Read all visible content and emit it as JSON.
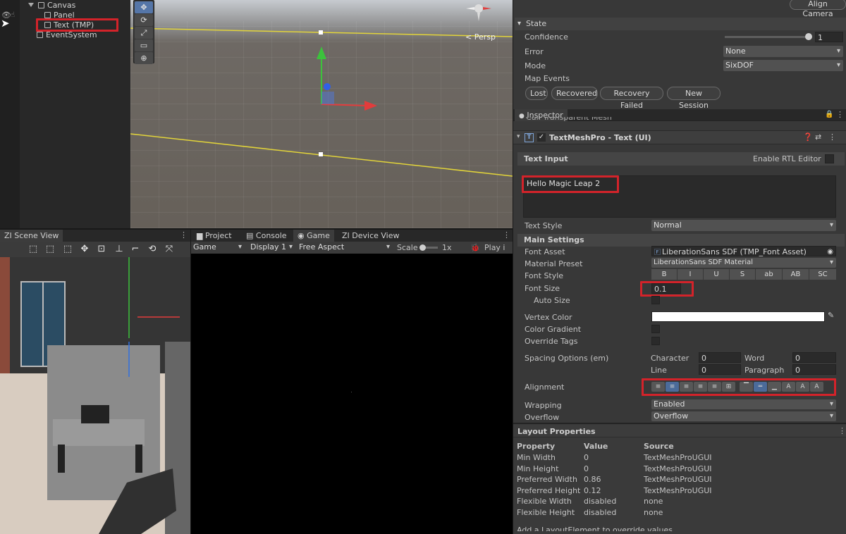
{
  "hierarchy": {
    "items": [
      {
        "label": "Canvas"
      },
      {
        "label": "Panel"
      },
      {
        "label": "Text (TMP)"
      },
      {
        "label": "EventSystem"
      }
    ]
  },
  "scene_top": {
    "persp_label": "< Persp",
    "tools": [
      "✥",
      "⟳",
      "⤢",
      "▭",
      "⊕"
    ]
  },
  "state_panel": {
    "align_camera": "Align Camera",
    "section": "State",
    "confidence_label": "Confidence",
    "confidence_value": "1",
    "confidence_fraction": 1.0,
    "error_label": "Error",
    "error_value": "None",
    "mode_label": "Mode",
    "mode_value": "SixDOF",
    "map_events_label": "Map Events",
    "buttons": [
      "Lost",
      "Recovered",
      "Recovery Failed",
      "New Session"
    ]
  },
  "inspector": {
    "tab": "Inspector",
    "cut_row": "Cull Transparent Mesh",
    "component_title": "TextMeshPro - Text (UI)",
    "text_input_label": "Text Input",
    "rtl_label": "Enable RTL Editor",
    "text_value": "Hello Magic Leap 2",
    "text_style_label": "Text Style",
    "text_style_value": "Normal",
    "main_settings": "Main Settings",
    "font_asset_label": "Font Asset",
    "font_asset_value": "LiberationSans SDF (TMP_Font Asset)",
    "material_preset_label": "Material Preset",
    "material_preset_value": "LiberationSans SDF Material",
    "font_style_label": "Font Style",
    "font_style_buttons": [
      "B",
      "I",
      "U",
      "S",
      "ab",
      "AB",
      "SC"
    ],
    "font_size_label": "Font Size",
    "font_size_value": "0.1",
    "auto_size_label": "Auto Size",
    "vertex_color_label": "Vertex Color",
    "color_gradient_label": "Color Gradient",
    "override_tags_label": "Override Tags",
    "spacing_label": "Spacing Options (em)",
    "character_label": "Character",
    "character_value": "0",
    "word_label": "Word",
    "word_value": "0",
    "line_label": "Line",
    "line_value": "0",
    "paragraph_label": "Paragraph",
    "paragraph_value": "0",
    "alignment_label": "Alignment",
    "wrapping_label": "Wrapping",
    "wrapping_value": "Enabled",
    "overflow_label": "Overflow",
    "overflow_value": "Overflow"
  },
  "layout_properties": {
    "title": "Layout Properties",
    "headers": [
      "Property",
      "Value",
      "Source"
    ],
    "rows": [
      [
        "Min Width",
        "0",
        "TextMeshProUGUI"
      ],
      [
        "Min Height",
        "0",
        "TextMeshProUGUI"
      ],
      [
        "Preferred Width",
        "0.86",
        "TextMeshProUGUI"
      ],
      [
        "Preferred Height",
        "0.12",
        "TextMeshProUGUI"
      ],
      [
        "Flexible Width",
        "disabled",
        "none"
      ],
      [
        "Flexible Height",
        "disabled",
        "none"
      ]
    ],
    "footer": "Add a LayoutElement to override values"
  },
  "zi_scene": {
    "tab": "ZI Scene View"
  },
  "game_panel": {
    "tabs": [
      "Project",
      "Console",
      "Game",
      "ZI Device View"
    ],
    "display_mode": "Game",
    "display": "Display 1",
    "aspect": "Free Aspect",
    "scale_label": "Scale",
    "scale_value": "1x",
    "play_label": "Play i"
  }
}
